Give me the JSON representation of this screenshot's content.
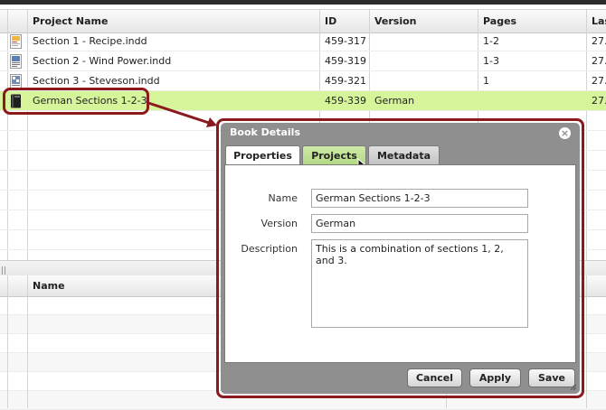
{
  "grid": {
    "columns": [
      "Project Name",
      "ID",
      "Version",
      "Pages",
      "Las"
    ],
    "rows": [
      {
        "name": "Section 1 - Recipe.indd",
        "id": "459-317",
        "version": "",
        "pages": "1-2",
        "last": "27."
      },
      {
        "name": "Section 2 - Wind Power.indd",
        "id": "459-319",
        "version": "",
        "pages": "1-3",
        "last": "27."
      },
      {
        "name": "Section 3 - Steveson.indd",
        "id": "459-321",
        "version": "",
        "pages": "1",
        "last": "27."
      },
      {
        "name": "German Sections 1-2-3",
        "id": "459-339",
        "version": "German",
        "pages": "",
        "last": "27."
      }
    ],
    "selected_color": "#d6f59b"
  },
  "bottom_grid": {
    "columns": [
      "Name"
    ]
  },
  "dialog": {
    "title": "Book Details",
    "tabs": [
      "Properties",
      "Projects",
      "Metadata"
    ],
    "active_tab": "Properties",
    "fields": {
      "name_label": "Name",
      "name_value": "German Sections 1-2-3",
      "version_label": "Version",
      "version_value": "German",
      "description_label": "Description",
      "description_value": "This is a combination of sections 1, 2, and 3."
    },
    "buttons": {
      "cancel": "Cancel",
      "apply": "Apply",
      "save": "Save"
    }
  },
  "colors": {
    "callout": "#8a1a1e",
    "dialog_frame": "#8f8f8f"
  }
}
